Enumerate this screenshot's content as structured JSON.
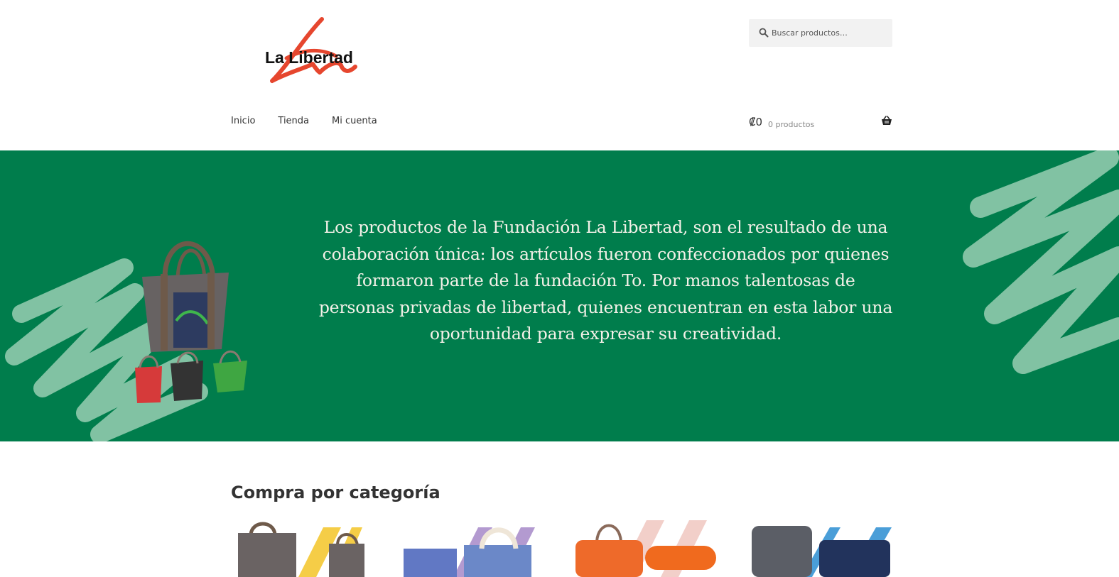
{
  "header": {
    "logo_text": "La Libertad",
    "search": {
      "placeholder": "Buscar productos…",
      "value": ""
    },
    "nav": [
      {
        "label": "Inicio"
      },
      {
        "label": "Tienda"
      },
      {
        "label": "Mi cuenta"
      }
    ],
    "cart": {
      "amount": "₡0",
      "count": "0 productos"
    }
  },
  "banner": {
    "text": "Los productos de la Fundación La Libertad, son el resultado de una colaboración única: los artículos fueron confeccionados por quienes formaron parte de la fundación To. Por manos talentosas de personas privadas de libertad, quienes encuentran en esta labor una oportunidad para expresar su creatividad."
  },
  "main": {
    "section_title": "Compra por categoría",
    "categories": [
      {
        "accent": "#f5cd47"
      },
      {
        "accent": "#b39ad0"
      },
      {
        "accent": "#f2cfc9"
      },
      {
        "accent": "#4a9ed8"
      }
    ]
  },
  "colors": {
    "banner_bg": "#007d4c",
    "scribble": "#88c6a8",
    "logo_red": "#e6462e"
  }
}
